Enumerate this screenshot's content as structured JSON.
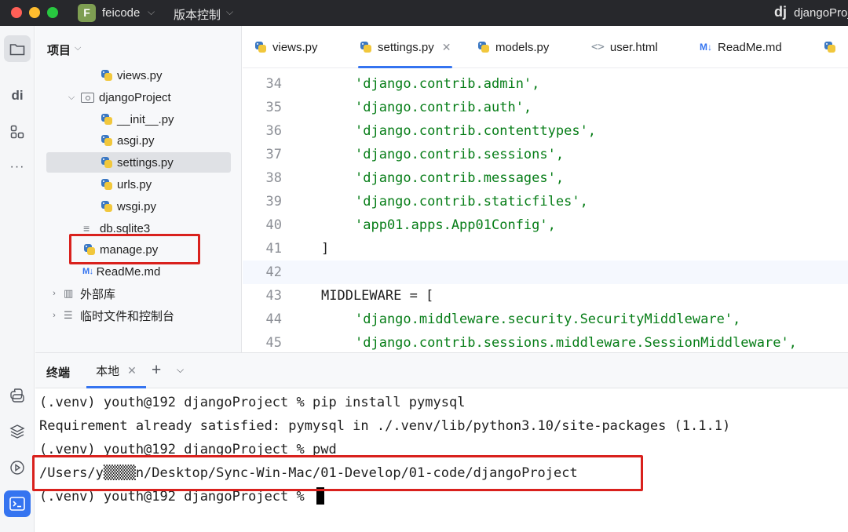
{
  "titlebar": {
    "project_badge": "F",
    "project_name": "feicode",
    "vcs_label": "版本控制",
    "right_logo": "dj",
    "right_title": "djangoProject"
  },
  "toolstrip": {
    "icons": [
      "folder-icon",
      "django-icon",
      "structure-icon",
      "more-icon",
      "python-console-icon",
      "layers-icon",
      "services-icon",
      "terminal-icon"
    ],
    "more_glyph": "···"
  },
  "project_panel": {
    "title": "项目",
    "tree": [
      {
        "label": "views.py",
        "kind": "py"
      },
      {
        "label": "djangoProject",
        "kind": "folder"
      },
      {
        "label": "__init__.py",
        "kind": "py"
      },
      {
        "label": "asgi.py",
        "kind": "py"
      },
      {
        "label": "settings.py",
        "kind": "py"
      },
      {
        "label": "urls.py",
        "kind": "py"
      },
      {
        "label": "wsgi.py",
        "kind": "py"
      },
      {
        "label": "db.sqlite3",
        "kind": "file"
      },
      {
        "label": "manage.py",
        "kind": "py"
      },
      {
        "label": "ReadMe.md",
        "kind": "md"
      },
      {
        "label": "外部库",
        "kind": "lib"
      },
      {
        "label": "临时文件和控制台",
        "kind": "scratch"
      }
    ]
  },
  "editor": {
    "tabs": [
      {
        "label": "views.py"
      },
      {
        "label": "settings.py"
      },
      {
        "label": "models.py"
      },
      {
        "label": "user.html"
      },
      {
        "label": "ReadMe.md"
      }
    ],
    "md_badge": "M↓",
    "lines": [
      {
        "num": "34",
        "text": "'django.contrib.admin',"
      },
      {
        "num": "35",
        "text": "'django.contrib.auth',"
      },
      {
        "num": "36",
        "text": "'django.contrib.contenttypes',"
      },
      {
        "num": "37",
        "text": "'django.contrib.sessions',"
      },
      {
        "num": "38",
        "text": "'django.contrib.messages',"
      },
      {
        "num": "39",
        "text": "'django.contrib.staticfiles',"
      },
      {
        "num": "40",
        "text": "'app01.apps.App01Config',"
      },
      {
        "num": "41",
        "text": "]"
      },
      {
        "num": "42",
        "text": ""
      },
      {
        "num": "43",
        "text": "MIDDLEWARE = ["
      },
      {
        "num": "44",
        "text": "'django.middleware.security.SecurityMiddleware',"
      },
      {
        "num": "45",
        "text": "'django.contrib.sessions.middleware.SessionMiddleware',"
      }
    ]
  },
  "terminal": {
    "title": "终端",
    "tab_label": "本地",
    "lines": [
      "(.venv) youth@192 djangoProject % pip install pymysql",
      "Requirement already satisfied: pymysql in ./.venv/lib/python3.10/site-packages (1.1.1)",
      "(.venv) youth@192 djangoProject % pwd",
      "/Users/y▒▒▒▒n/Desktop/Sync-Win-Mac/01-Develop/01-code/djangoProject",
      "(.venv) youth@192 djangoProject % "
    ]
  }
}
